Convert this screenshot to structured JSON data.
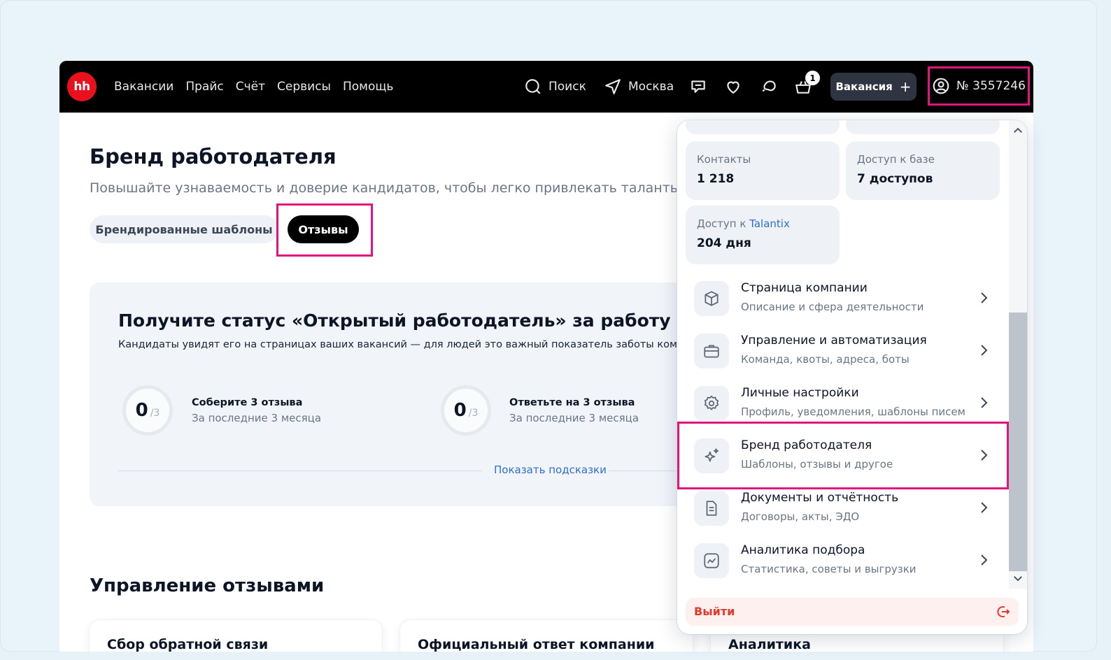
{
  "header": {
    "logo_text": "hh",
    "nav": [
      "Вакансии",
      "Прайс",
      "Счёт",
      "Сервисы",
      "Помощь"
    ],
    "search_label": "Поиск",
    "city_label": "Москва",
    "cart_count": "1",
    "vacancy_button": "Вакансия",
    "vacancy_button_icon": "+",
    "account_label": "№ 3557246"
  },
  "page": {
    "title": "Бренд работодателя",
    "subtitle": "Повышайте узнаваемость и доверие кандидатов, чтобы легко привлекать таланты",
    "tabs": [
      {
        "label": "Брендированные шаблоны",
        "active": false
      },
      {
        "label": "Отзывы",
        "active": true
      }
    ]
  },
  "status_card": {
    "title": "Получите статус «Открытый работодатель» за работу с отзывами",
    "text": "Кандидаты увидят его на страницах ваших вакансий — для людей это важный показатель заботы компании",
    "goals": [
      {
        "count": "0",
        "total": "/3",
        "title": "Соберите 3 отзыва",
        "subtitle": "За последние 3 месяца"
      },
      {
        "count": "0",
        "total": "/3",
        "title": "Ответьте на 3 отзыва",
        "subtitle": "За последние 3 месяца"
      }
    ],
    "hint_link": "Показать подсказки"
  },
  "reviews_section": {
    "title": "Управление отзывами",
    "cards": [
      "Сбор обратной связи",
      "Официальный ответ компании",
      "Аналитика"
    ]
  },
  "account_menu": {
    "tiles": [
      {
        "label": "Контакты",
        "value": "1 218"
      },
      {
        "label": "Доступ к базе",
        "value": "7 доступов"
      },
      {
        "label": "Доступ к ",
        "label_link": "Talantix",
        "value": "204 дня"
      }
    ],
    "items": [
      {
        "title": "Страница компании",
        "subtitle": "Описание и сфера деятельности",
        "icon": "cube-icon"
      },
      {
        "title": "Управление и автоматизация",
        "subtitle": "Команда, квоты, адреса, боты",
        "icon": "briefcase-icon"
      },
      {
        "title": "Личные настройки",
        "subtitle": "Профиль, уведомления, шаблоны писем",
        "icon": "gear-icon"
      },
      {
        "title": "Бренд работодателя",
        "subtitle": "Шаблоны, отзывы и другое",
        "icon": "sparkle-icon"
      },
      {
        "title": "Документы и отчётность",
        "subtitle": "Договоры, акты, ЭДО",
        "icon": "document-icon"
      },
      {
        "title": "Аналитика подбора",
        "subtitle": "Статистика, советы и выгрузки",
        "icon": "chart-icon"
      }
    ],
    "logout_label": "Выйти"
  },
  "colors": {
    "brand_red": "#e8111c",
    "highlight": "#e0157f",
    "link_blue": "#2f6fd1",
    "logout_red": "#e23b2b"
  }
}
